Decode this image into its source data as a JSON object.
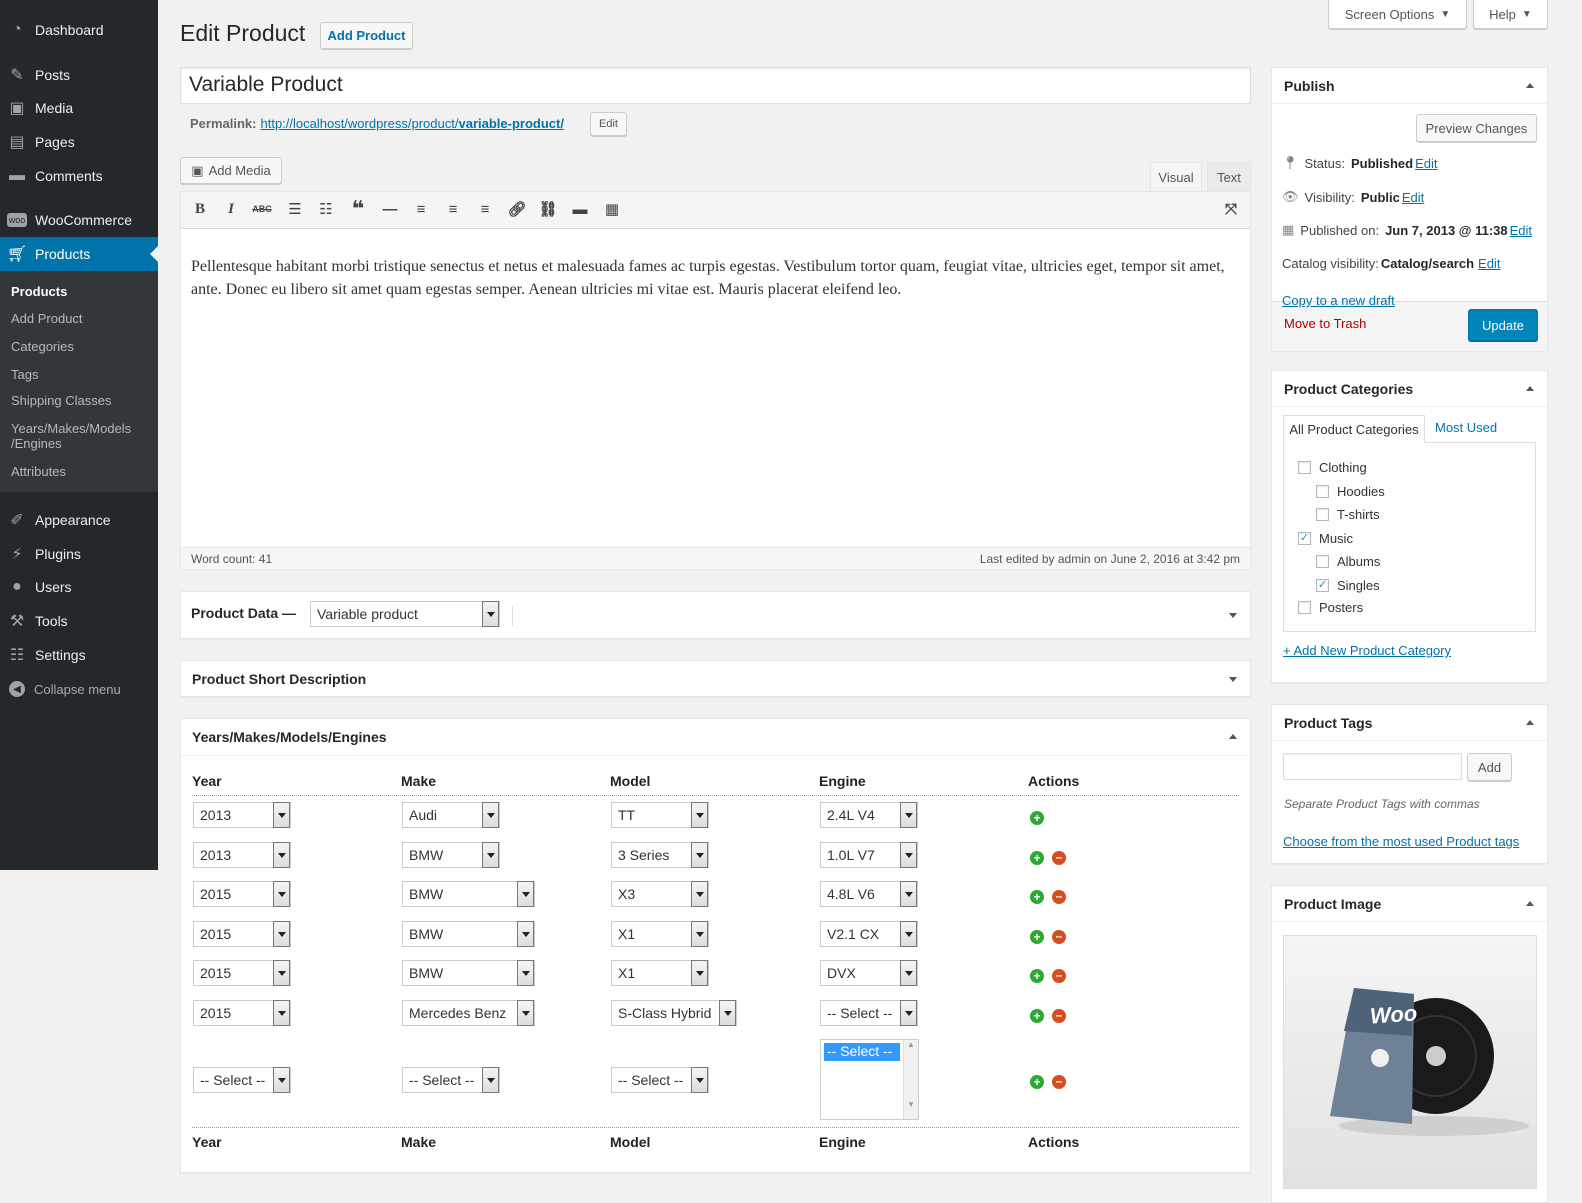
{
  "sidebar": {
    "items": [
      {
        "label": "Dashboard",
        "icon": "dashboard-icon"
      },
      {
        "label": "Posts",
        "icon": "pin-icon"
      },
      {
        "label": "Media",
        "icon": "media-icon"
      },
      {
        "label": "Pages",
        "icon": "pages-icon"
      },
      {
        "label": "Comments",
        "icon": "comment-icon"
      },
      {
        "label": "WooCommerce",
        "icon": "woo-icon"
      },
      {
        "label": "Products",
        "icon": "cart-icon"
      },
      {
        "label": "Appearance",
        "icon": "brush-icon"
      },
      {
        "label": "Plugins",
        "icon": "plug-icon"
      },
      {
        "label": "Users",
        "icon": "user-icon"
      },
      {
        "label": "Tools",
        "icon": "wrench-icon"
      },
      {
        "label": "Settings",
        "icon": "sliders-icon"
      }
    ],
    "submenu": [
      "Products",
      "Add Product",
      "Categories",
      "Tags",
      "Shipping Classes",
      "Years/Makes/Models",
      "/Engines",
      "Attributes"
    ],
    "collapse": "Collapse menu"
  },
  "header": {
    "screen_options": "Screen Options",
    "help": "Help",
    "title": "Edit Product",
    "add_product": "Add Product"
  },
  "post": {
    "title": "Variable Product",
    "permalink_label": "Permalink:",
    "permalink_base": "http://localhost/wordpress/product/",
    "permalink_slug": "variable-product/",
    "edit": "Edit",
    "add_media": "Add Media",
    "tab_visual": "Visual",
    "tab_text": "Text",
    "content": "Pellentesque habitant morbi tristique senectus et netus et malesuada fames ac turpis egestas. Vestibulum tortor quam, feugiat vitae, ultricies eget, tempor sit amet, ante. Donec eu libero sit amet quam egestas semper. Aenean ultricies mi vitae est. Mauris placerat eleifend leo.",
    "word_count": "Word count: 41",
    "last_edited": "Last edited by admin on June 2, 2016 at 3:42 pm"
  },
  "product_data": {
    "label": "Product Data —",
    "type": "Variable product"
  },
  "short_desc": {
    "title": "Product Short Description"
  },
  "ymme": {
    "title": "Years/Makes/Models/Engines",
    "headers": [
      "Year",
      "Make",
      "Model",
      "Engine",
      "Actions"
    ],
    "rows": [
      {
        "year": "2013",
        "make": "Audi",
        "model": "TT",
        "engine": "2.4L V4"
      },
      {
        "year": "2013",
        "make": "BMW",
        "model": "3 Series",
        "engine": "1.0L V7"
      },
      {
        "year": "2015",
        "make": "BMW",
        "model": "X3",
        "engine": "4.8L V6"
      },
      {
        "year": "2015",
        "make": "BMW",
        "model": "X1",
        "engine": "V2.1 CX"
      },
      {
        "year": "2015",
        "make": "BMW",
        "model": "X1",
        "engine": "DVX"
      },
      {
        "year": "2015",
        "make": "Mercedes Benz",
        "model": "S-Class Hybrid",
        "engine": "-- Select --"
      }
    ],
    "new_row": {
      "year": "-- Select --",
      "make": "-- Select --",
      "model": "-- Select --",
      "engine": "-- Select --"
    }
  },
  "publish": {
    "title": "Publish",
    "preview": "Preview Changes",
    "status_label": "Status:",
    "status": "Published",
    "visibility_label": "Visibility:",
    "visibility": "Public",
    "published_label": "Published on:",
    "published": "Jun 7, 2013 @ 11:38",
    "catalog_label": "Catalog visibility:",
    "catalog": "Catalog/search",
    "edit": "Edit",
    "copy": "Copy to a new draft",
    "trash": "Move to Trash",
    "update": "Update"
  },
  "categories": {
    "title": "Product Categories",
    "tab_all": "All Product Categories",
    "tab_used": "Most Used",
    "items": [
      {
        "label": "Clothing",
        "checked": false
      },
      {
        "label": "Hoodies",
        "checked": false
      },
      {
        "label": "T-shirts",
        "checked": false
      },
      {
        "label": "Music",
        "checked": true
      },
      {
        "label": "Albums",
        "checked": false
      },
      {
        "label": "Singles",
        "checked": true
      },
      {
        "label": "Posters",
        "checked": false
      }
    ],
    "add_new": "+ Add New Product Category"
  },
  "tags": {
    "title": "Product Tags",
    "add": "Add",
    "hint": "Separate Product Tags with commas",
    "choose": "Choose from the most used Product tags"
  },
  "image": {
    "title": "Product Image",
    "logo": "Woo"
  },
  "colors": {
    "accent": "#0073aa",
    "sidebar": "#23282d",
    "update": "#0085ba"
  }
}
